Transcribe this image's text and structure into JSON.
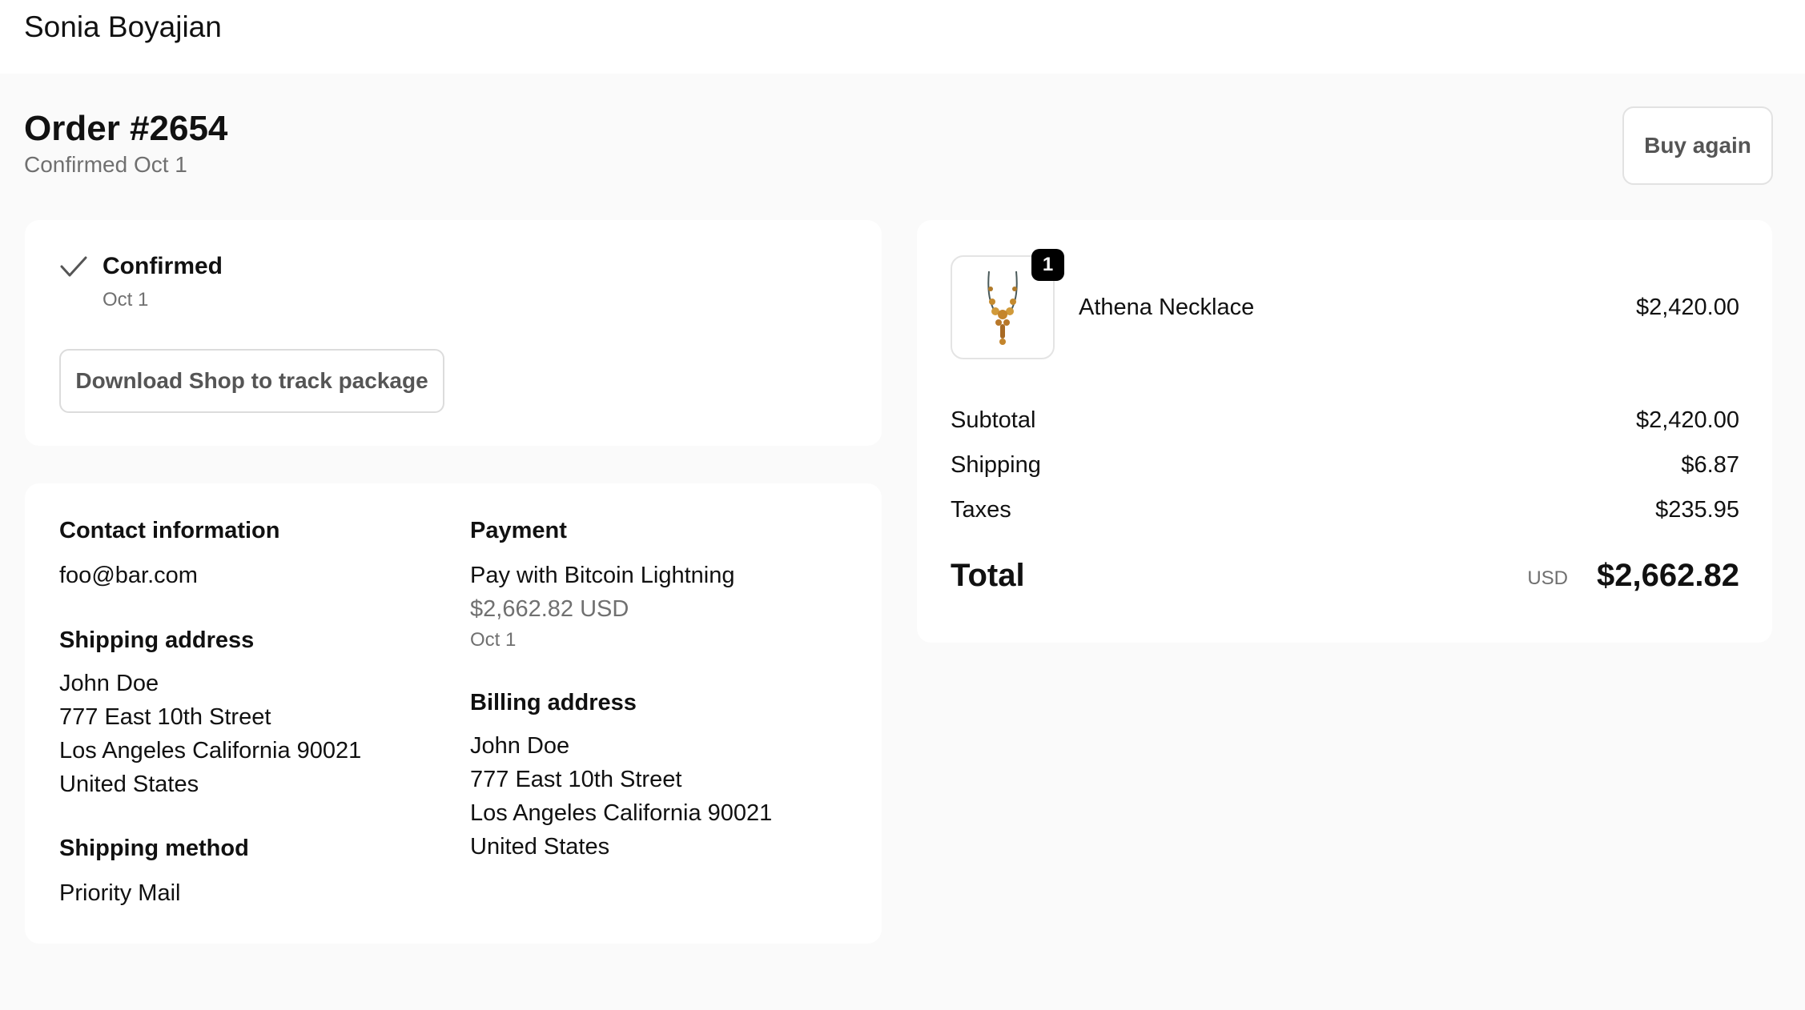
{
  "header": {
    "store_name": "Sonia Boyajian"
  },
  "order": {
    "title": "Order #2654",
    "subtitle": "Confirmed Oct 1",
    "buy_again_label": "Buy again"
  },
  "status": {
    "title": "Confirmed",
    "date": "Oct 1",
    "track_button_label": "Download Shop to track package"
  },
  "contact": {
    "heading": "Contact information",
    "email": "foo@bar.com"
  },
  "shipping_address": {
    "heading": "Shipping address",
    "lines": [
      "John Doe",
      "777 East 10th Street",
      "Los Angeles California 90021",
      "United States"
    ]
  },
  "shipping_method": {
    "heading": "Shipping method",
    "value": "Priority Mail"
  },
  "payment": {
    "heading": "Payment",
    "method": "Pay with Bitcoin Lightning",
    "amount": "$2,662.82 USD",
    "date": "Oct 1"
  },
  "billing_address": {
    "heading": "Billing address",
    "lines": [
      "John Doe",
      "777 East 10th Street",
      "Los Angeles California 90021",
      "United States"
    ]
  },
  "line_item": {
    "image_icon": "necklace-image",
    "quantity": "1",
    "name": "Athena Necklace",
    "price": "$2,420.00"
  },
  "summary": {
    "subtotal_label": "Subtotal",
    "subtotal": "$2,420.00",
    "shipping_label": "Shipping",
    "shipping": "$6.87",
    "taxes_label": "Taxes",
    "taxes": "$235.95",
    "total_label": "Total",
    "currency": "USD",
    "total": "$2,662.82"
  },
  "colors": {
    "background": "#fafafa",
    "card": "#ffffff",
    "muted_text": "#707070",
    "badge": "#000000"
  }
}
